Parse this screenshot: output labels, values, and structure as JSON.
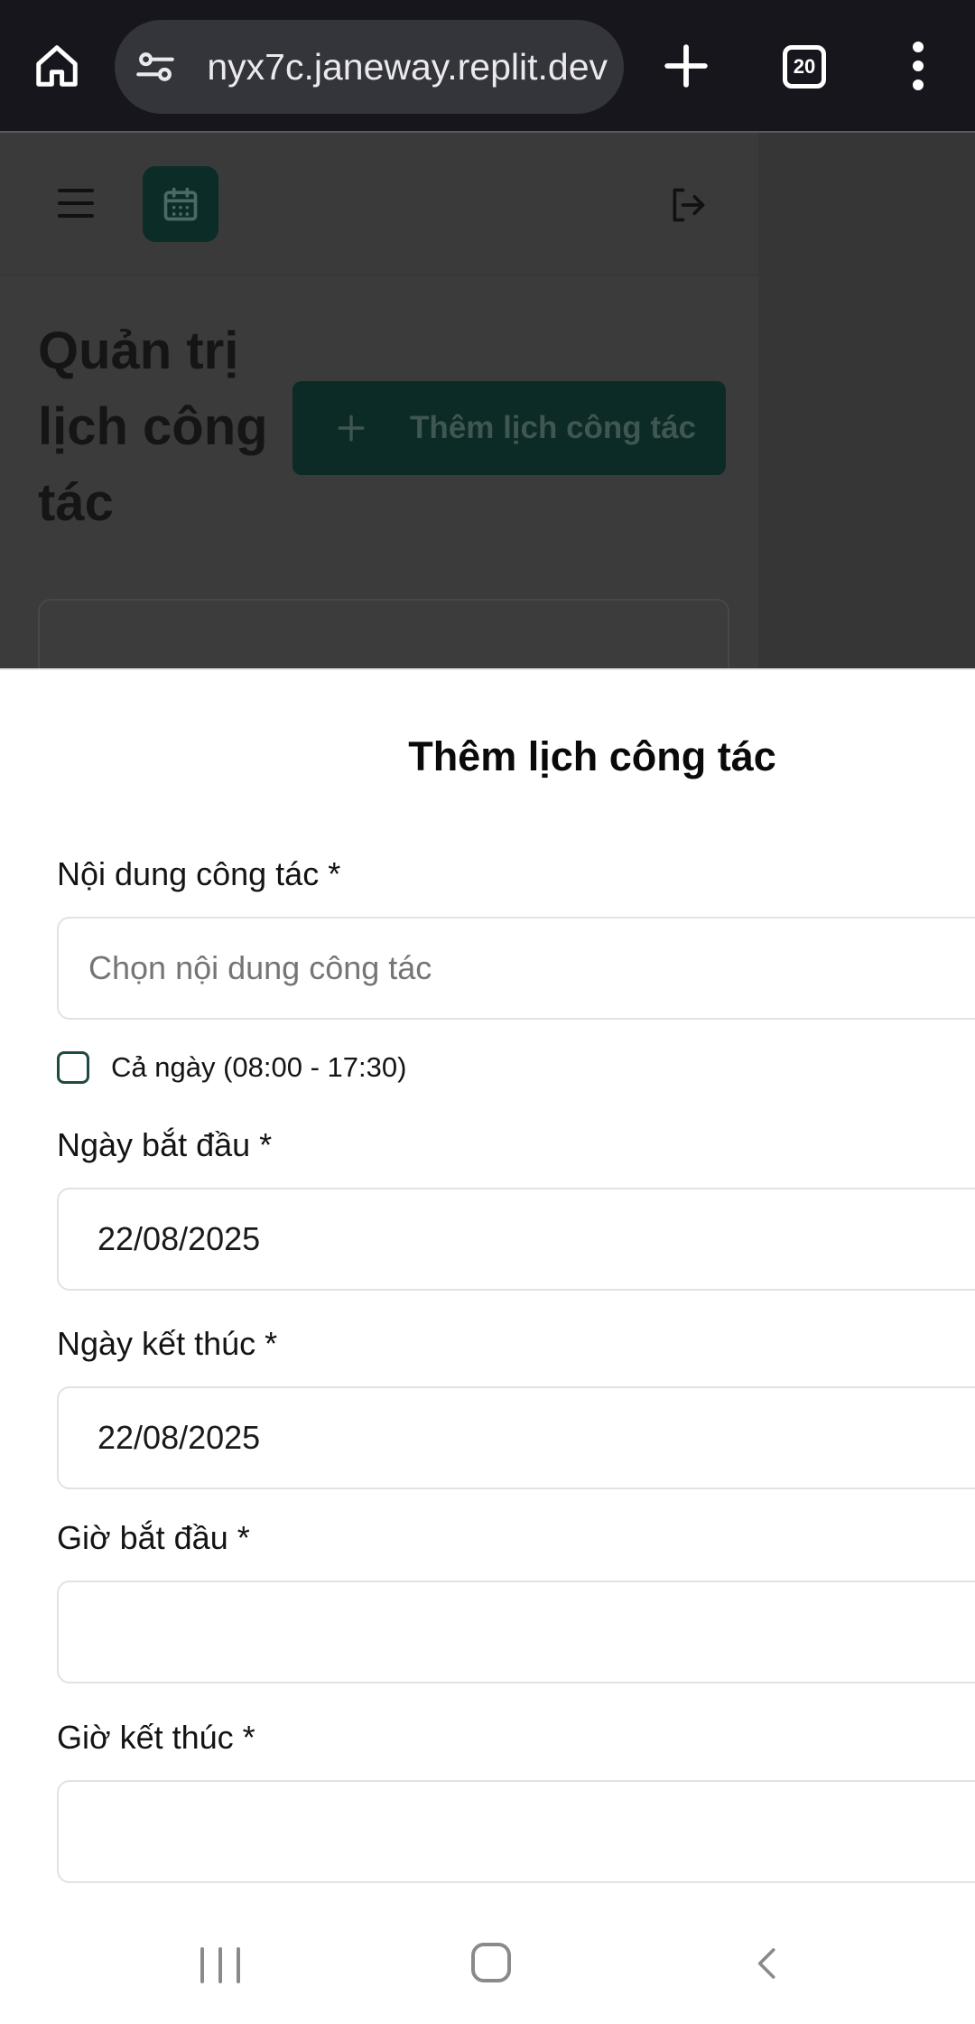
{
  "browser": {
    "url": "nyx7c.janeway.replit.dev",
    "tab_count": "20",
    "icons": {
      "home": "home-icon",
      "site_settings": "tune-icon",
      "new_tab": "plus-icon",
      "tabs": "tab-switcher-icon",
      "menu": "more-vert-icon"
    }
  },
  "background_page": {
    "title": "Quản trị lịch công tác",
    "add_button_label": "Thêm lịch công tác",
    "icons": {
      "menu": "hamburger-icon",
      "logo": "calendar-icon",
      "logout": "logout-icon"
    },
    "colors": {
      "brand": "#0c2c28",
      "overlay": "#3b3b3b"
    }
  },
  "modal": {
    "title": "Thêm lịch công tác",
    "content_label": "Nội dung công tác *",
    "content_placeholder": "Chọn nội dung công tác",
    "all_day_label": "Cả ngày (08:00 - 17:30)",
    "all_day_checked": false,
    "start_date_label": "Ngày bắt đầu *",
    "start_date_value": "22/08/2025",
    "end_date_label": "Ngày kết thúc *",
    "end_date_value": "22/08/2025",
    "start_time_label": "Giờ bắt đầu *",
    "start_time_value": "",
    "end_time_label": "Giờ kết thúc *",
    "end_time_value": ""
  },
  "nav_bar": {
    "icons": {
      "recents": "recents-icon",
      "home": "home-circle-icon",
      "back": "back-icon"
    }
  }
}
